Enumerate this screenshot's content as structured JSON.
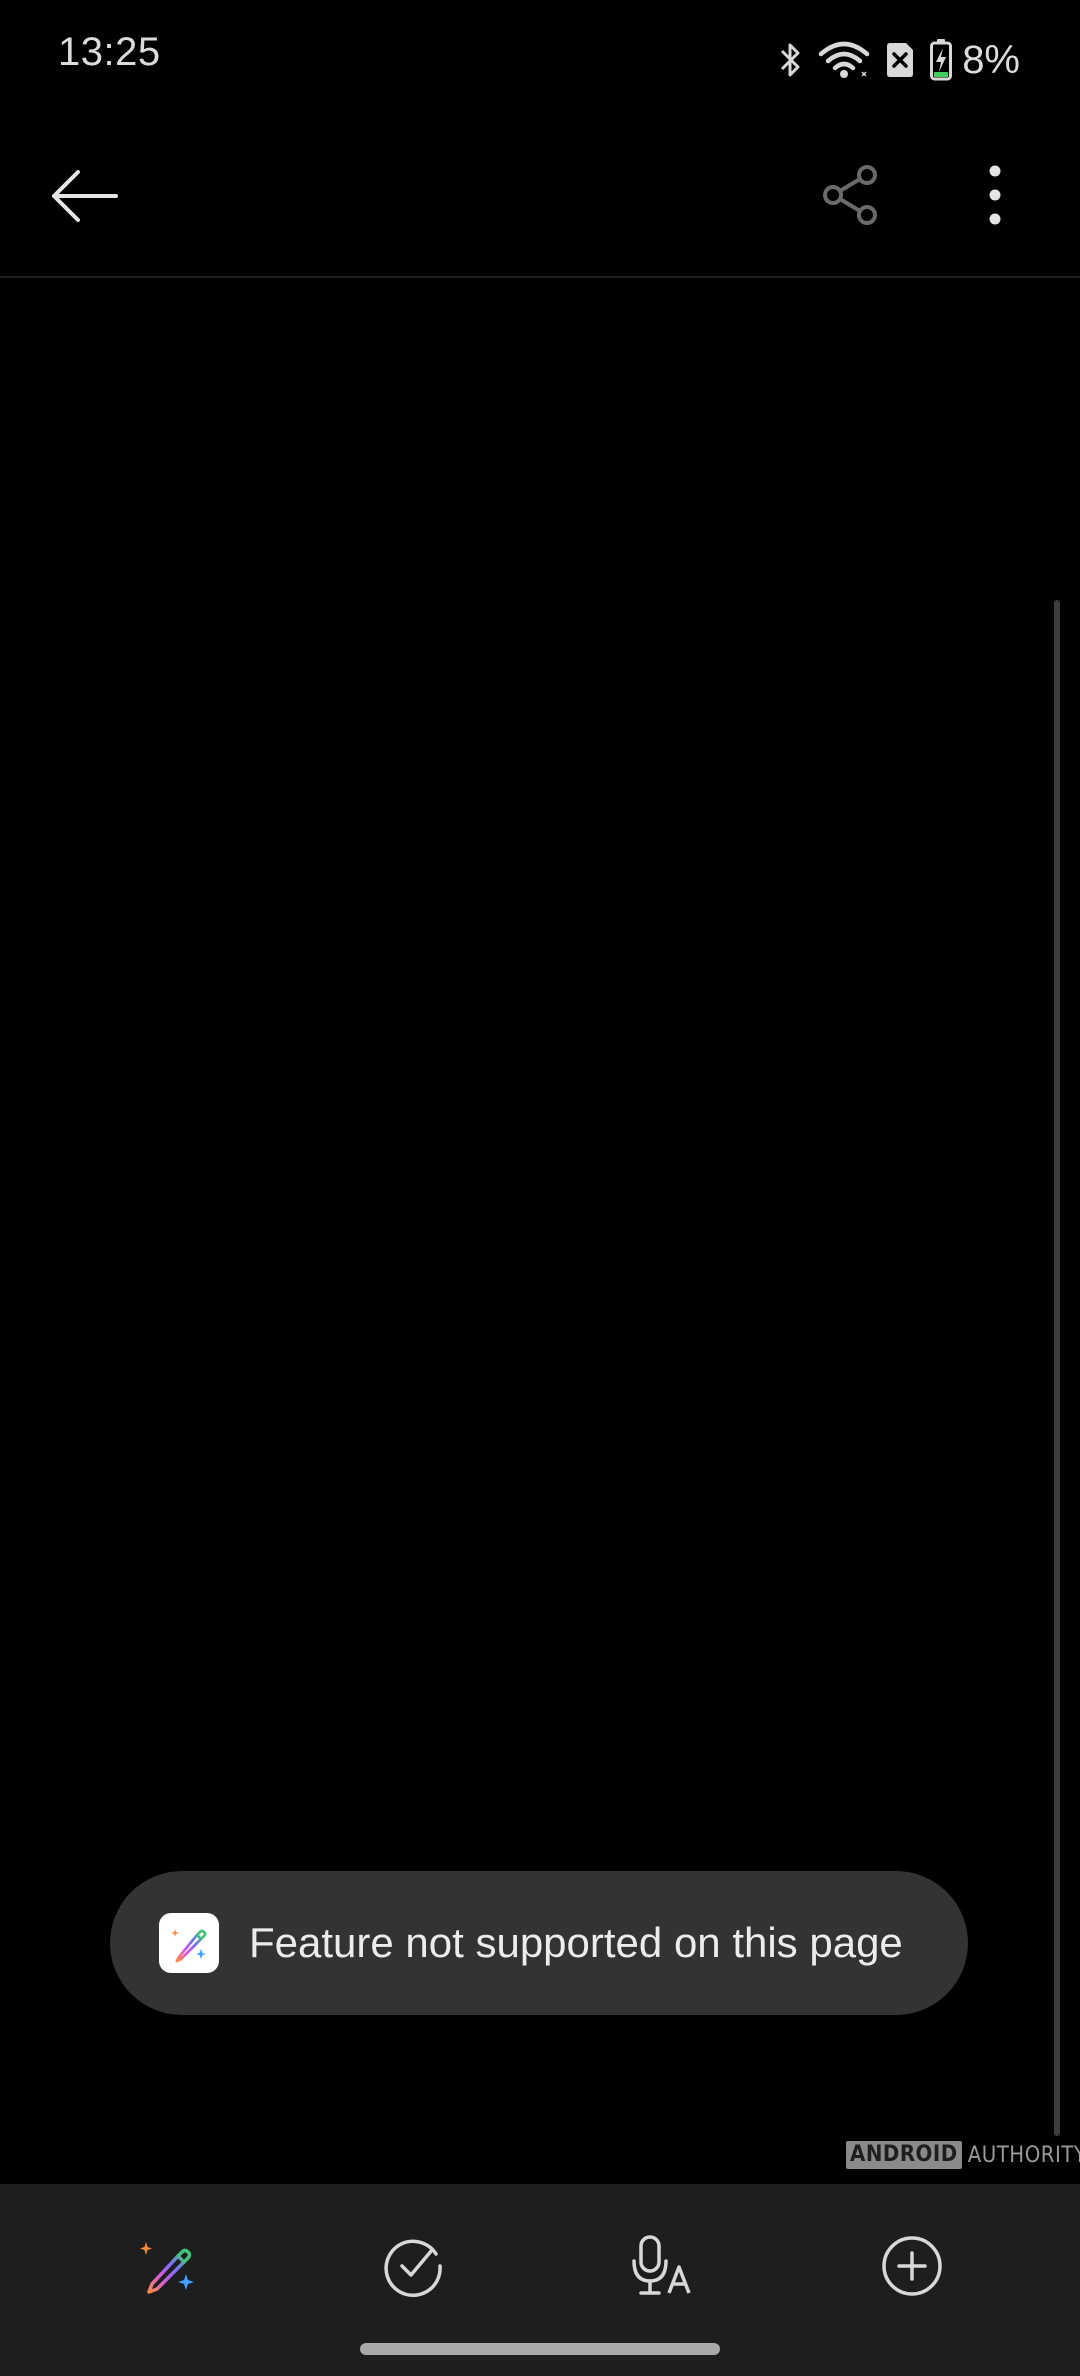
{
  "status_bar": {
    "time": "13:25",
    "battery_text": "8%",
    "icons": [
      "bluetooth-icon",
      "wifi-icon",
      "no-sim-icon",
      "battery-charging-icon"
    ]
  },
  "app_bar": {
    "back_icon": "arrow-left-icon",
    "share_icon": "share-icon",
    "more_icon": "more-vertical-icon"
  },
  "toast": {
    "message": "Feature not supported on this page",
    "icon": "ai-pen-sparkle-icon"
  },
  "bottom_toolbar": {
    "items": [
      {
        "icon": "ai-pen-sparkle-icon"
      },
      {
        "icon": "check-circle-icon"
      },
      {
        "icon": "voice-to-text-icon"
      },
      {
        "icon": "add-circle-icon"
      }
    ]
  },
  "watermark": {
    "brand_box": "ANDROID",
    "brand_text": "AUTHORITY"
  },
  "colors": {
    "background": "#000000",
    "toolbar": "#1e1e1e",
    "toast": "#333333",
    "text": "#ececec"
  }
}
